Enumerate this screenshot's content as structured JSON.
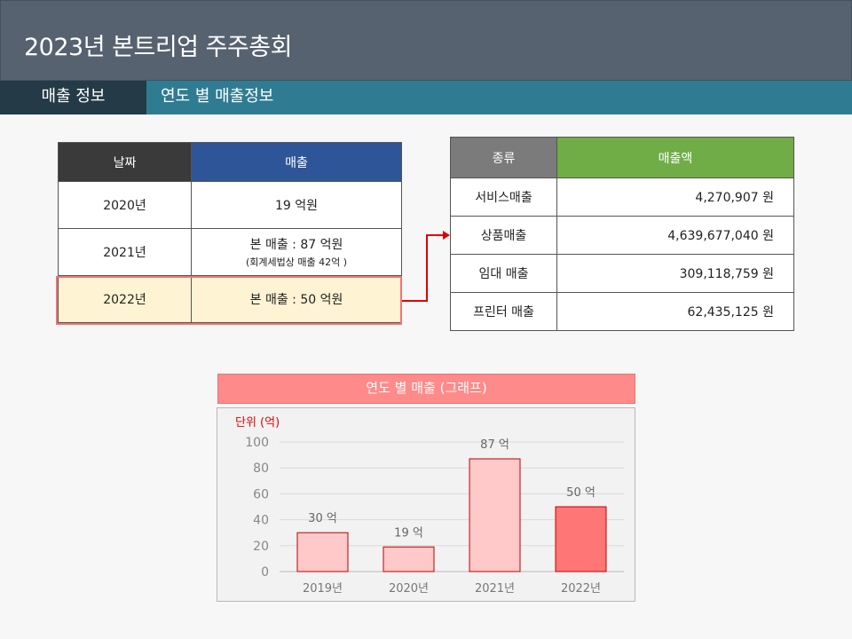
{
  "header": {
    "title": "2023년 본트리업 주주총회"
  },
  "tabs": [
    {
      "label": "매출 정보"
    },
    {
      "label": "연도 별 매출정보"
    }
  ],
  "table1": {
    "headers": [
      "날짜",
      "매출"
    ],
    "rows": [
      {
        "date": "2020년",
        "sales": "19 억원",
        "note": ""
      },
      {
        "date": "2021년",
        "sales": "본 매출 :  87 억원",
        "note": "(회계세법상 매출 42억 )"
      },
      {
        "date": "2022년",
        "sales": "본 매출 :  50 억원",
        "note": ""
      }
    ]
  },
  "table2": {
    "headers": [
      "종류",
      "매출액"
    ],
    "rows": [
      {
        "type": "서비스매출",
        "amount": "4,270,907  원"
      },
      {
        "type": "상품매출",
        "amount": "4,639,677,040  원"
      },
      {
        "type": "임대 매출",
        "amount": "309,118,759  원"
      },
      {
        "type": "프린터 매출",
        "amount": "62,435,125  원"
      }
    ]
  },
  "chart_title": "연도 별 매출 (그래프)",
  "colors": {
    "bar_normal": "#ffc9c9",
    "bar_highlight": "#ff7676",
    "bar_border": "#c00000",
    "unit_label": "#e00000"
  },
  "chart_data": {
    "type": "bar",
    "title": "",
    "ylabel": "단위 (억)",
    "categories": [
      "2019년",
      "2020년",
      "2021년",
      "2022년"
    ],
    "values": [
      30,
      19,
      87,
      50
    ],
    "data_labels": [
      "30 억",
      "19 억",
      "87 억",
      "50 억"
    ],
    "yticks": [
      "0",
      "20",
      "40",
      "60",
      "80",
      "100"
    ],
    "ylim": [
      0,
      100
    ],
    "highlight_index": 3,
    "grid": true
  }
}
